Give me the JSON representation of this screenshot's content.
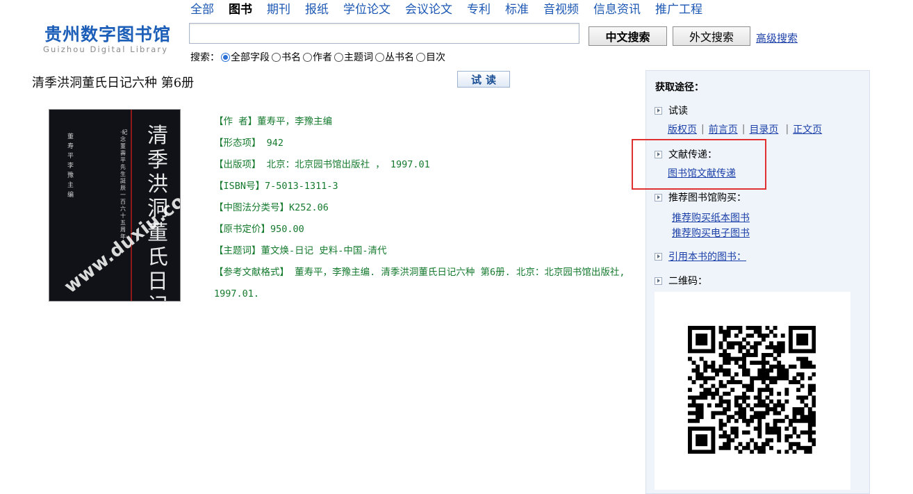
{
  "logo": {
    "main": "贵州数字图书馆",
    "sub": "Guizhou Digital Library"
  },
  "nav": [
    "全部",
    "图书",
    "期刊",
    "报纸",
    "学位论文",
    "会议论文",
    "专利",
    "标准",
    "音视频",
    "信息资讯",
    "推广工程"
  ],
  "nav_active": "图书",
  "search": {
    "input_value": "",
    "button_cn": "中文搜索",
    "button_foreign": "外文搜索",
    "advanced": "高级搜索",
    "scope_label": "搜索：",
    "scopes": [
      "全部字段",
      "书名",
      "作者",
      "主题词",
      "丛书名",
      "目次"
    ],
    "selected_scope": "全部字段"
  },
  "book": {
    "title": "清季洪洞董氏日记六种  第6册",
    "trial_button": "试读",
    "cover": {
      "title": "清季洪洞董氏日记六種",
      "subtitle": "·紀念董壽平先生誕辰一百六十五周年·",
      "authors": "董寿平 李豫 主编",
      "watermark": "www.duxiu.com"
    },
    "meta": [
      "【作  者】董寿平，李豫主编",
      "【形态项】 942",
      "【出版项】 北京：北京园书馆出版社 ， 1997.01",
      "【ISBN号】7-5013-1311-3",
      "【中图法分类号】K252.06",
      "【原书定价】950.00",
      "【主题词】董文焕-日记 史料-中国-清代",
      "【参考文献格式】 董寿平，李豫主编. 清季洪洞董氏日记六种 第6册. 北京：北京园书馆出版社, 1997.01."
    ]
  },
  "panel": {
    "heading": "获取途径：",
    "trial": {
      "label": "试读",
      "links": [
        "版权页",
        "前言页",
        "目录页",
        "正文页"
      ]
    },
    "delivery": {
      "label": "文献传递：",
      "link": "图书馆文献传递"
    },
    "purchase": {
      "label": "推荐图书馆购买：",
      "links": [
        "推荐购买纸本图书",
        "推荐购买电子图书"
      ]
    },
    "cited": {
      "label": "引用本书的图书："
    },
    "qr": {
      "label": "二维码："
    }
  },
  "colors": {
    "nav_link": "#1b57b3",
    "meta_text": "#157a2e",
    "panel_bg": "#eef4fa",
    "highlight_box": "#e03030"
  }
}
